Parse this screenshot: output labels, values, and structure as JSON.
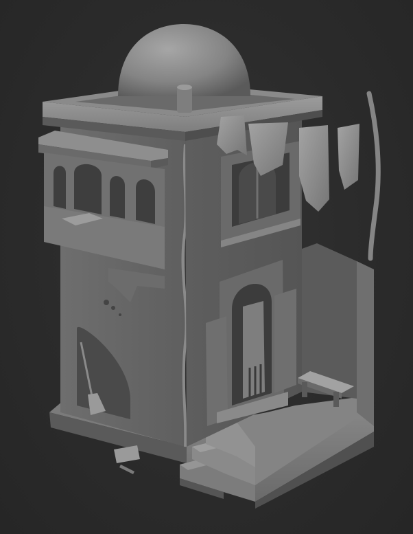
{
  "scene": {
    "subject": "sculpted-building-model",
    "colors": {
      "background": "#2b2b2b",
      "clay_light": "#9a9a9a",
      "clay_mid": "#7a7a7a",
      "clay_dark": "#4e4e4e",
      "clay_shadow": "#3a3a3a"
    }
  }
}
